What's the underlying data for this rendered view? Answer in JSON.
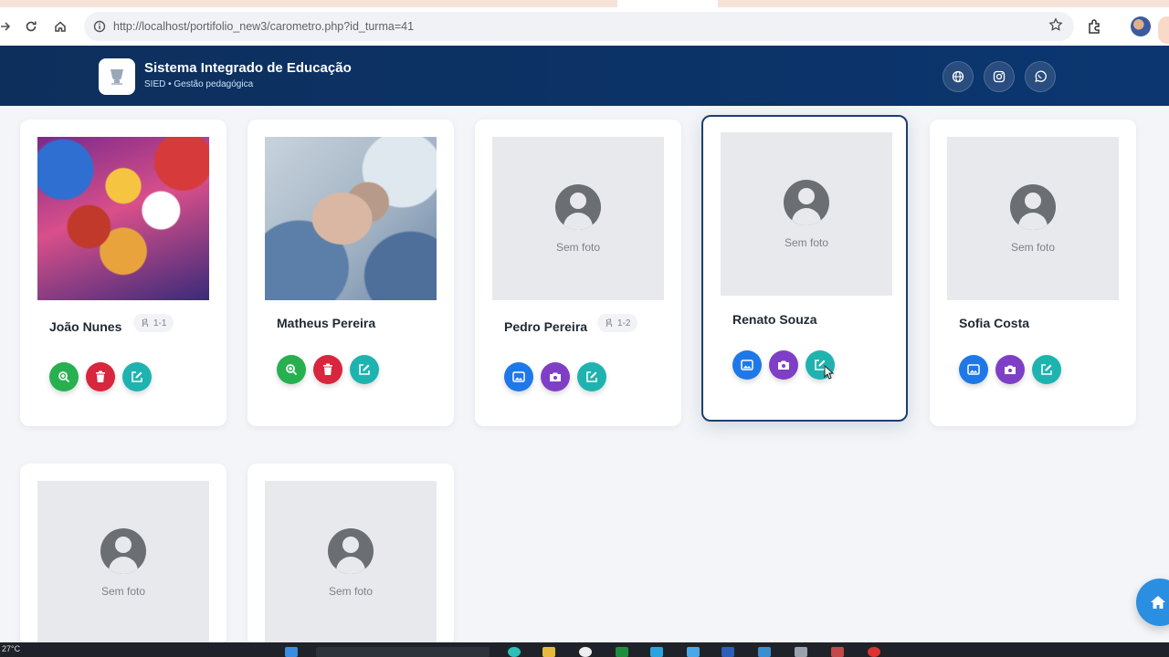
{
  "browser": {
    "url": "http://localhost/portifolio_new3/carometro.php?id_turma=41"
  },
  "header": {
    "title": "Sistema Integrado de Educação",
    "subtitle": "SIED • Gestão pedagógica",
    "icons": [
      "globe-icon",
      "instagram-icon",
      "whatsapp-icon"
    ]
  },
  "students": [
    {
      "name": "João Nunes",
      "seat": "1-1",
      "photo": "image",
      "actions": [
        "zoom",
        "delete",
        "edit"
      ]
    },
    {
      "name": "Matheus Pereira",
      "seat": "",
      "photo": "image",
      "actions": [
        "zoom",
        "delete",
        "edit"
      ]
    },
    {
      "name": "Pedro Pereira",
      "seat": "1-2",
      "photo": "none",
      "actions": [
        "gallery",
        "camera",
        "edit"
      ]
    },
    {
      "name": "Renato Souza",
      "seat": "",
      "photo": "none",
      "actions": [
        "gallery",
        "camera",
        "edit"
      ]
    },
    {
      "name": "Sofia Costa",
      "seat": "",
      "photo": "none",
      "actions": [
        "gallery",
        "camera",
        "edit"
      ]
    },
    {
      "name": "",
      "seat": "",
      "photo": "none",
      "actions": []
    },
    {
      "name": "",
      "seat": "",
      "photo": "none",
      "actions": []
    }
  ],
  "no_photo_label": "Sem foto",
  "taskbar": {
    "temperature": "27°C"
  },
  "colors": {
    "header": "#0d2f5c",
    "green": "#27b04f",
    "red": "#d7263d",
    "teal": "#1fb3b0",
    "blue": "#1f78e8",
    "purple": "#7e3fc6"
  }
}
